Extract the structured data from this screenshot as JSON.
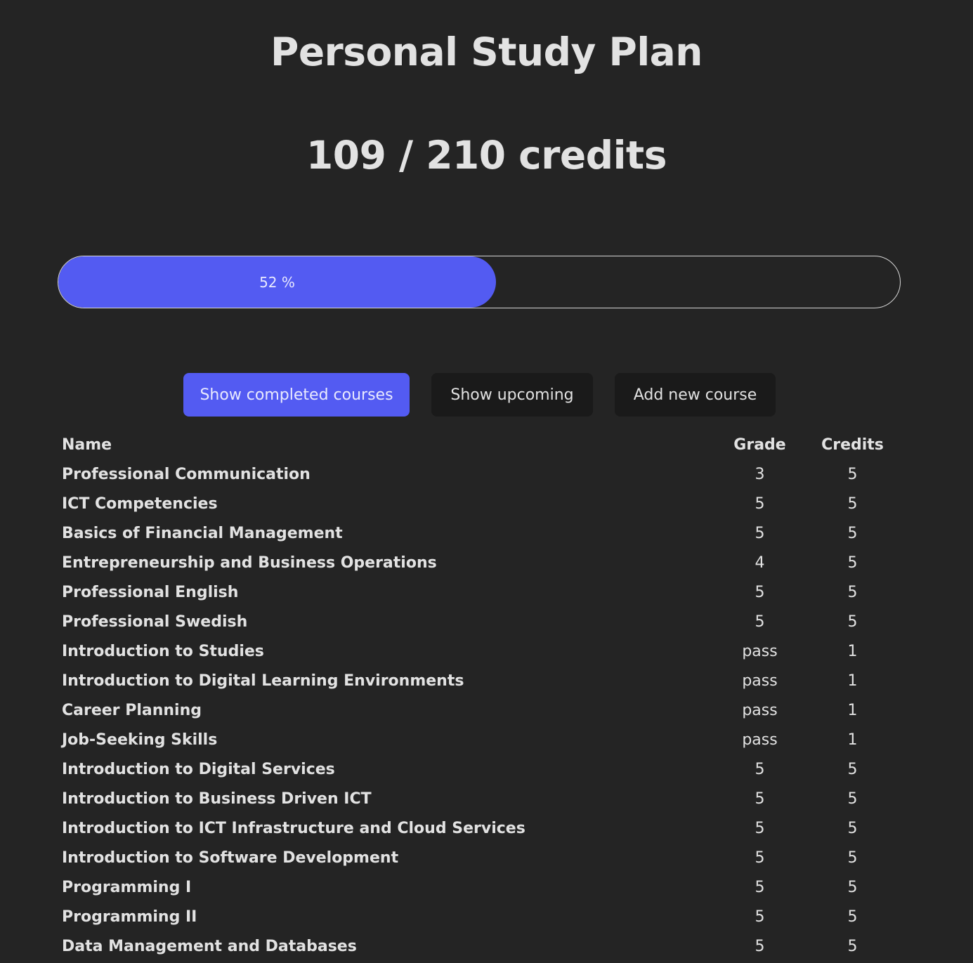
{
  "title": "Personal Study Plan",
  "credits": {
    "text": "109 / 210 credits",
    "earned": 109,
    "required": 210
  },
  "progress": {
    "percent": 52,
    "label": "52 %"
  },
  "buttons": {
    "completed": "Show completed courses",
    "upcoming": "Show upcoming",
    "add": "Add new course"
  },
  "accent_color": "#535bf2",
  "table": {
    "headers": {
      "name": "Name",
      "grade": "Grade",
      "credits": "Credits"
    },
    "rows": [
      {
        "name": "Professional Communication",
        "grade": "3",
        "credits": "5"
      },
      {
        "name": "ICT Competencies",
        "grade": "5",
        "credits": "5"
      },
      {
        "name": "Basics of Financial Management",
        "grade": "5",
        "credits": "5"
      },
      {
        "name": "Entrepreneurship and Business Operations",
        "grade": "4",
        "credits": "5"
      },
      {
        "name": "Professional English",
        "grade": "5",
        "credits": "5"
      },
      {
        "name": "Professional Swedish",
        "grade": "5",
        "credits": "5"
      },
      {
        "name": "Introduction to Studies",
        "grade": "pass",
        "credits": "1"
      },
      {
        "name": "Introduction to Digital Learning Environments",
        "grade": "pass",
        "credits": "1"
      },
      {
        "name": "Career Planning",
        "grade": "pass",
        "credits": "1"
      },
      {
        "name": "Job-Seeking Skills",
        "grade": "pass",
        "credits": "1"
      },
      {
        "name": "Introduction to Digital Services",
        "grade": "5",
        "credits": "5"
      },
      {
        "name": "Introduction to Business Driven ICT",
        "grade": "5",
        "credits": "5"
      },
      {
        "name": "Introduction to ICT Infrastructure and Cloud Services",
        "grade": "5",
        "credits": "5"
      },
      {
        "name": "Introduction to Software Development",
        "grade": "5",
        "credits": "5"
      },
      {
        "name": "Programming I",
        "grade": "5",
        "credits": "5"
      },
      {
        "name": "Programming II",
        "grade": "5",
        "credits": "5"
      },
      {
        "name": "Data Management and Databases",
        "grade": "5",
        "credits": "5"
      }
    ]
  }
}
